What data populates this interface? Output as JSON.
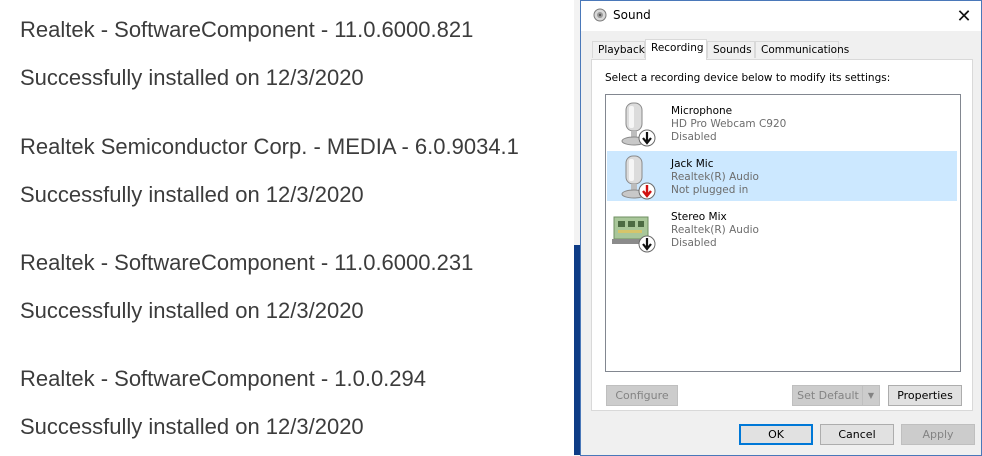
{
  "updates": [
    {
      "title": "Realtek - SoftwareComponent - 11.0.6000.821",
      "status": "Successfully installed on 12/3/2020"
    },
    {
      "title": "Realtek Semiconductor Corp. - MEDIA - 6.0.9034.1",
      "status": "Successfully installed on 12/3/2020"
    },
    {
      "title": "Realtek - SoftwareComponent - 11.0.6000.231",
      "status": "Successfully installed on 12/3/2020"
    },
    {
      "title": "Realtek - SoftwareComponent - 1.0.0.294",
      "status": "Successfully installed on 12/3/2020"
    }
  ],
  "dialog": {
    "title": "Sound",
    "close_glyph": "✕",
    "tabs": [
      "Playback",
      "Recording",
      "Sounds",
      "Communications"
    ],
    "active_tab": "Recording",
    "instruction": "Select a recording device below to modify its settings:",
    "devices": [
      {
        "name": "Microphone",
        "sub": "HD Pro Webcam C920",
        "state": "Disabled",
        "icon": "microphone-icon",
        "badge": "disabled-arrow-icon",
        "selected": false
      },
      {
        "name": "Jack Mic",
        "sub": "Realtek(R) Audio",
        "state": "Not plugged in",
        "icon": "microphone-icon",
        "badge": "unplugged-arrow-icon",
        "selected": true
      },
      {
        "name": "Stereo Mix",
        "sub": "Realtek(R) Audio",
        "state": "Disabled",
        "icon": "sound-card-icon",
        "badge": "disabled-arrow-icon",
        "selected": false
      }
    ],
    "buttons": {
      "configure": "Configure",
      "set_default": "Set Default",
      "properties": "Properties",
      "ok": "OK",
      "cancel": "Cancel",
      "apply": "Apply"
    },
    "colors": {
      "selected_row": "#cce8ff",
      "border_accent": "#0078d7",
      "badge_red": "#d01010"
    }
  }
}
